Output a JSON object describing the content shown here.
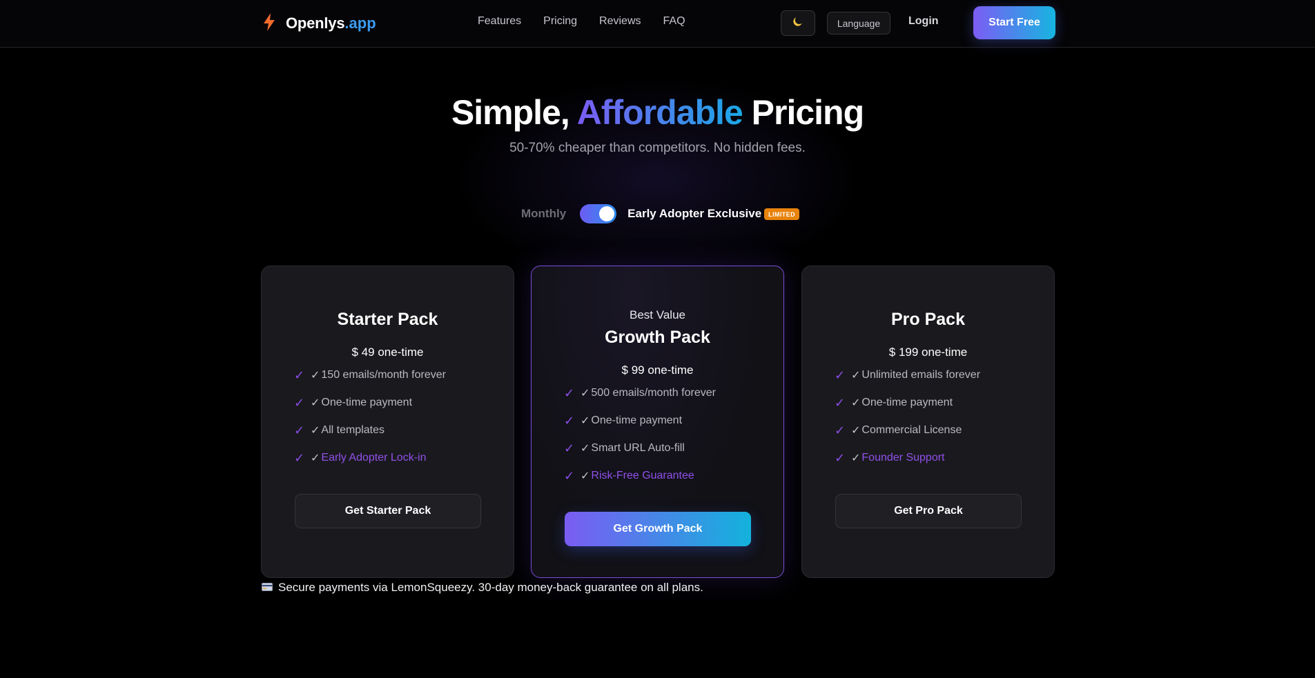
{
  "brand": {
    "name": "Openlys",
    "tld": ".app",
    "icon": "lightning-bolt-icon",
    "icon_color": "#f26b2c"
  },
  "nav": {
    "links": [
      "Features",
      "Pricing",
      "Reviews",
      "FAQ"
    ],
    "theme_icon": "moon-icon",
    "language_label": "Language",
    "login_label": "Login",
    "cta_label": "Start Free"
  },
  "hero": {
    "title_before": "Simple, ",
    "title_accent": "Affordable",
    "title_after": " Pricing",
    "subtitle": "50-70% cheaper than competitors. No hidden fees."
  },
  "billing_toggle": {
    "off_label": "Monthly",
    "on_label": "Early Adopter Exclusive",
    "badge": "LIMITED",
    "enabled": true
  },
  "plans": [
    {
      "eyebrow": "",
      "name": "Starter Pack",
      "price": "$ 49 one-time",
      "features": [
        {
          "text": "150 emails/month forever",
          "highlight": false
        },
        {
          "text": "One-time payment",
          "highlight": false
        },
        {
          "text": "All templates",
          "highlight": false
        },
        {
          "text": "Early Adopter Lock-in",
          "highlight": true
        }
      ],
      "button": "Get Starter Pack",
      "featured": false
    },
    {
      "eyebrow": "Best Value",
      "name": "Growth Pack",
      "price": "$ 99 one-time",
      "features": [
        {
          "text": "500 emails/month forever",
          "highlight": false
        },
        {
          "text": "One-time payment",
          "highlight": false
        },
        {
          "text": "Smart URL Auto-fill",
          "highlight": false
        },
        {
          "text": "Risk-Free Guarantee",
          "highlight": true
        }
      ],
      "button": "Get Growth Pack",
      "featured": true
    },
    {
      "eyebrow": "",
      "name": "Pro Pack",
      "price": "$ 199 one-time",
      "features": [
        {
          "text": "Unlimited emails forever",
          "highlight": false
        },
        {
          "text": "One-time payment",
          "highlight": false
        },
        {
          "text": "Commercial License",
          "highlight": false
        },
        {
          "text": "Founder Support",
          "highlight": true
        }
      ],
      "button": "Get Pro Pack",
      "featured": false
    }
  ],
  "footnote": {
    "icon": "credit-card-icon",
    "text": "Secure payments via LemonSqueezy. 30-day money-back guarantee on all plans."
  },
  "colors": {
    "background": "#000000",
    "accent_purple": "#7b5cf3",
    "accent_cyan": "#13b2dc",
    "badge_orange": "#e8830c",
    "check_purple": "#8a4de6"
  }
}
